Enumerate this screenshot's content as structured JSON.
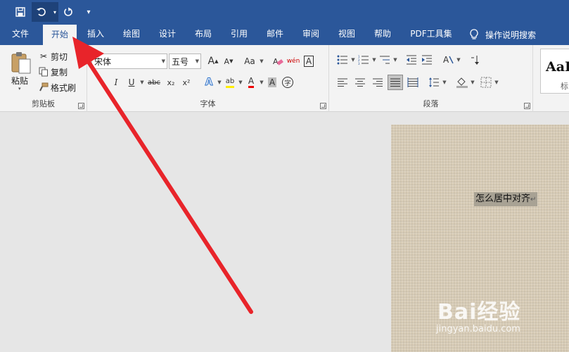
{
  "quick_access": {
    "dropdown_label": "▾"
  },
  "tabs": [
    {
      "label": "文件"
    },
    {
      "label": "开始"
    },
    {
      "label": "插入"
    },
    {
      "label": "绘图"
    },
    {
      "label": "设计"
    },
    {
      "label": "布局"
    },
    {
      "label": "引用"
    },
    {
      "label": "邮件"
    },
    {
      "label": "审阅"
    },
    {
      "label": "视图"
    },
    {
      "label": "帮助"
    },
    {
      "label": "PDF工具集"
    }
  ],
  "tell_me": {
    "label": "操作说明搜索"
  },
  "clipboard": {
    "group_label": "剪贴板",
    "paste_label": "粘贴",
    "cut_label": "剪切",
    "copy_label": "复制",
    "format_painter_label": "格式刷"
  },
  "font": {
    "group_label": "字体",
    "font_name": "宋体",
    "font_size": "五号",
    "grow_label": "A",
    "shrink_label": "A",
    "case_label": "Aa",
    "phonetic_label": "wén",
    "border_label": "A",
    "italic_label": "I",
    "underline_label": "U",
    "strike_label": "abc",
    "subscript_label": "x₂",
    "superscript_label": "x²",
    "effects_label": "A",
    "highlight_label": "ab",
    "color_label": "A",
    "shading_label": "A",
    "enclose_label": "字"
  },
  "paragraph": {
    "group_label": "段落"
  },
  "styles": {
    "sample": "AaB",
    "name": "标"
  },
  "document": {
    "text": "怎么居中对齐",
    "mark": "↵"
  },
  "watermark": {
    "brand": "Bai经验",
    "url": "jingyan.baidu.com"
  },
  "colors": {
    "accent": "#2b579a",
    "arrow": "#e8242a"
  }
}
